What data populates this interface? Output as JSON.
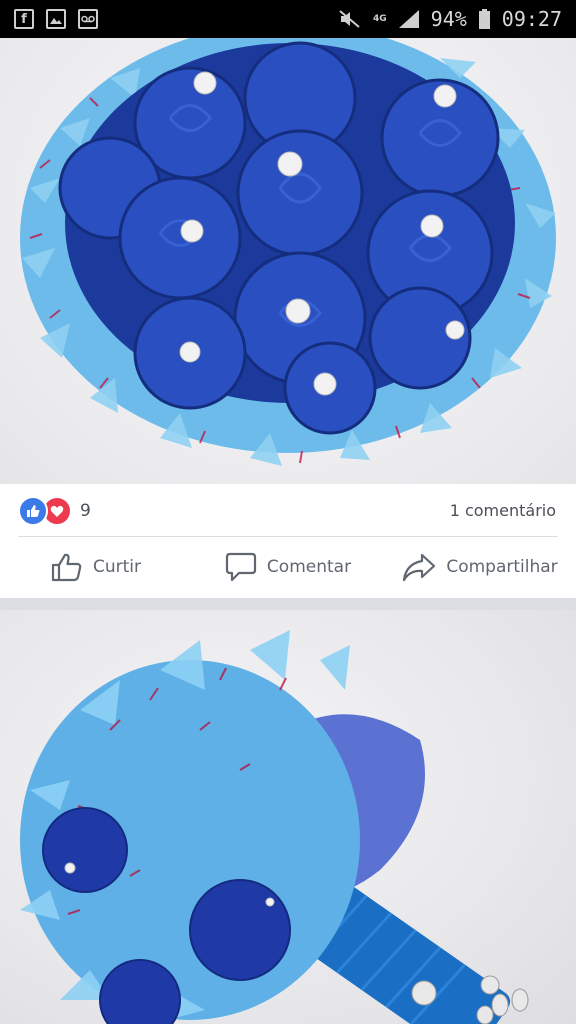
{
  "status_bar": {
    "network": "4G",
    "battery": "94%",
    "time": "09:27",
    "left_icons": [
      "facebook-icon",
      "gallery-icon",
      "voicemail-icon"
    ],
    "right_icons": [
      "mute-icon",
      "signal-icon",
      "battery-icon"
    ]
  },
  "post": {
    "reactions": {
      "types": [
        "like",
        "love"
      ],
      "count": "9"
    },
    "comments_label": "1 comentário",
    "actions": [
      {
        "label": "Curtir",
        "icon": "thumbs-up-icon"
      },
      {
        "label": "Comentar",
        "icon": "comment-icon"
      },
      {
        "label": "Compartilhar",
        "icon": "share-icon"
      }
    ]
  },
  "colors": {
    "like_blue": "#3b7be8",
    "love_red": "#ee3a4f",
    "rose_blue": "#1f3fa8",
    "light_flower": "#5fb6ea",
    "ribbon": "#1a6fc4"
  }
}
